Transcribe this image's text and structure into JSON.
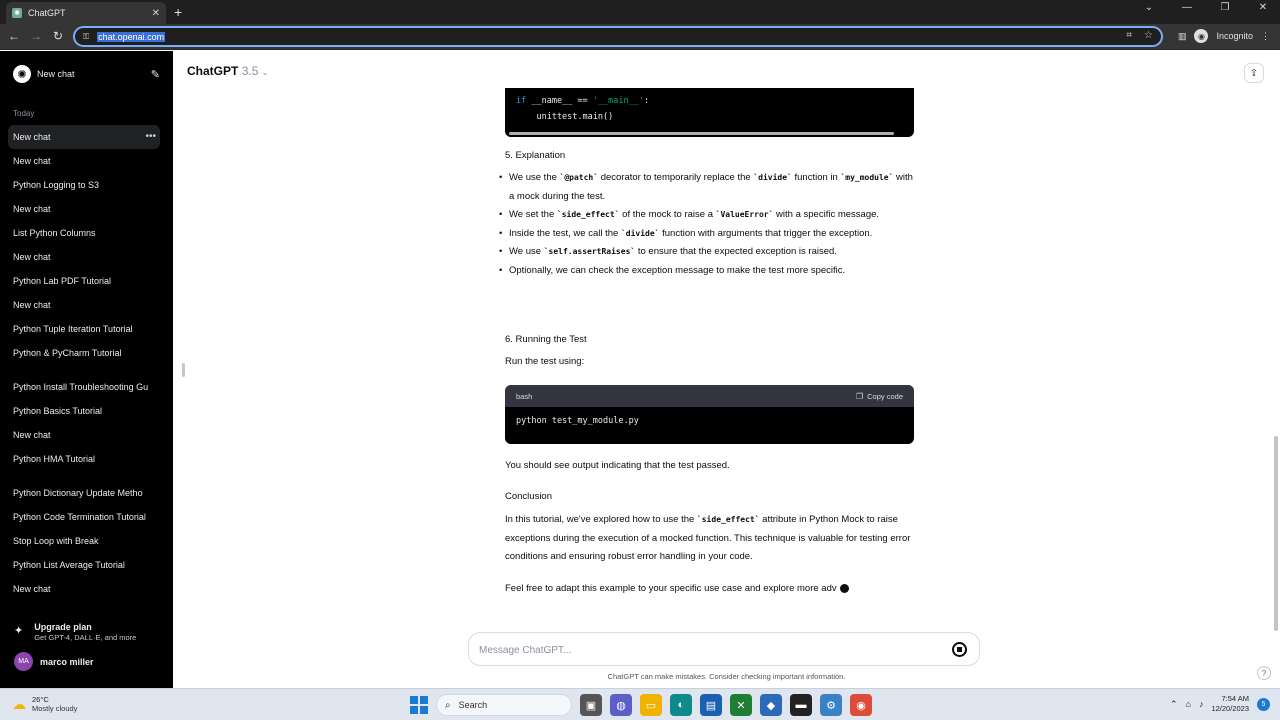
{
  "browser": {
    "tab_title": "ChatGPT",
    "url": "chat.openai.com",
    "incognito_label": "Incognito"
  },
  "sidebar": {
    "new_chat_label": "New chat",
    "section_today": "Today",
    "items": [
      {
        "label": "New chat"
      },
      {
        "label": "New chat"
      },
      {
        "label": "Python Logging to S3"
      },
      {
        "label": "New chat"
      },
      {
        "label": "List Python Columns"
      },
      {
        "label": "New chat"
      },
      {
        "label": "Python Lab PDF Tutorial"
      },
      {
        "label": "New chat"
      },
      {
        "label": "Python Tuple Iteration Tutorial"
      },
      {
        "label": "Python & PyCharm Tutorial"
      },
      {
        "label": "Python Install Troubleshooting Gu"
      },
      {
        "label": "Python Basics Tutorial"
      },
      {
        "label": "New chat"
      },
      {
        "label": "Python HMA Tutorial"
      },
      {
        "label": "Python Dictionary Update Metho"
      },
      {
        "label": "Python Code Termination Tutorial"
      },
      {
        "label": "Stop Loop with Break"
      },
      {
        "label": "Python List Average Tutorial"
      },
      {
        "label": "New chat"
      }
    ],
    "upgrade_title": "Upgrade plan",
    "upgrade_subtitle": "Get GPT-4, DALL·E, and more",
    "user_initials": "MA",
    "user_name": "marco miller"
  },
  "header": {
    "model_name": "ChatGPT",
    "model_version": "3.5"
  },
  "message": {
    "code_top_line1_kw": "if",
    "code_top_line1_mid": " __name__ == ",
    "code_top_line1_str": "'__main__'",
    "code_top_line1_end": ":",
    "code_top_line2": "    unittest.main()",
    "section5_heading": "5. Explanation",
    "b1_a": "We use the ",
    "b1_code1": "`@patch`",
    "b1_b": " decorator to temporarily replace the ",
    "b1_code2": "`divide`",
    "b1_c": " function in ",
    "b1_code3": "`my_module`",
    "b1_d": " with a mock during the test.",
    "b2_a": "We set the ",
    "b2_code1": "`side_effect`",
    "b2_b": " of the mock to raise a ",
    "b2_code2": "`ValueError`",
    "b2_c": " with a specific message.",
    "b3_a": "Inside the test, we call the ",
    "b3_code1": "`divide`",
    "b3_b": " function with arguments that trigger the exception.",
    "b4_a": "We use ",
    "b4_code1": "`self.assertRaises`",
    "b4_b": " to ensure that the expected exception is raised.",
    "b5": "Optionally, we can check the exception message to make the test more specific.",
    "section6_heading": "6. Running the Test",
    "run_intro": "Run the test using:",
    "codeblock_lang": "bash",
    "copy_code_label": "Copy code",
    "codeblock_cmd": "python test_my_module.py",
    "output_note": "You should see output indicating that the test passed.",
    "conclusion_heading": "Conclusion",
    "conclusion_a": "In this tutorial, we've explored how to use the ",
    "conclusion_code": "`side_effect`",
    "conclusion_b": " attribute in Python Mock to raise exceptions during the execution of a mocked function. This technique is valuable for testing error conditions and ensuring robust error handling in your code.",
    "final_line": "Feel free to adapt this example to your specific use case and explore more adv"
  },
  "composer": {
    "placeholder": "Message ChatGPT...",
    "disclaimer": "ChatGPT can make mistakes. Consider checking important information."
  },
  "taskbar": {
    "temperature": "26°C",
    "weather": "Mostly cloudy",
    "search_label": "Search",
    "time": "7:54 AM",
    "date": "12/20/2023",
    "notification_count": "5"
  },
  "colors": {
    "sidebar_bg": "#000000",
    "accent_url_highlight": "#3a6fd8",
    "avatar": "#8e44ad"
  }
}
